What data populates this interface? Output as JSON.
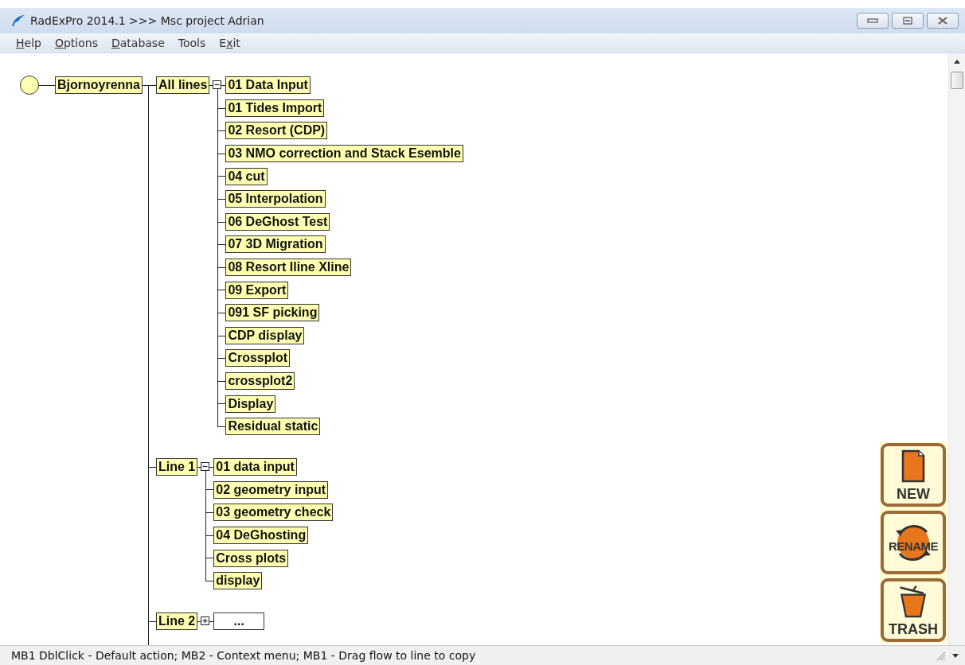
{
  "window": {
    "title": "RadExPro 2014.1 >>> Msc project Adrian"
  },
  "menu": [
    {
      "key": "H",
      "after": "elp"
    },
    {
      "key": "O",
      "after": "ptions"
    },
    {
      "key": "D",
      "after": "atabase"
    },
    {
      "before": "Tools"
    },
    {
      "before": "E",
      "key": "x",
      "after": "it"
    }
  ],
  "project": {
    "name": "Bjornoyrenna"
  },
  "lines": [
    {
      "name": "All lines",
      "expanded": true,
      "flows": [
        "01 Data Input",
        "01 Tides Import",
        "02 Resort (CDP)",
        "03 NMO correction and Stack Esemble",
        "04 cut",
        "05 Interpolation",
        "06 DeGhost Test",
        "07 3D Migration",
        "08 Resort Iline Xline",
        "09 Export",
        "091 SF picking",
        "CDP display",
        "Crossplot",
        "crossplot2",
        "Display",
        "Residual static"
      ]
    },
    {
      "name": "Line 1",
      "expanded": true,
      "flows": [
        "01 data input",
        "02 geometry input",
        "03 geometry check",
        "04 DeGhosting",
        "Cross plots",
        "display"
      ]
    },
    {
      "name": "Line 2",
      "expanded": false,
      "flows": [
        "..."
      ]
    }
  ],
  "tools": [
    {
      "kind": "new",
      "label": "NEW"
    },
    {
      "kind": "rename",
      "label": "RENAME"
    },
    {
      "kind": "trash",
      "label": "TRASH"
    }
  ],
  "status_bar": "MB1 DblClick - Default action; MB2 - Context menu; MB1 - Drag flow to line to copy"
}
